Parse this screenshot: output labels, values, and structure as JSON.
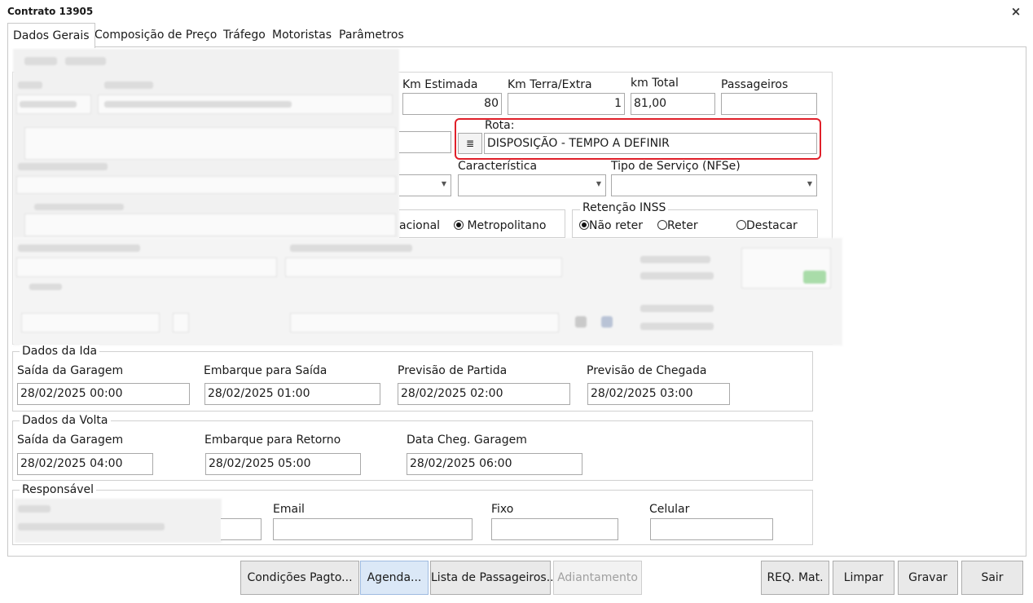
{
  "window": {
    "title": "Contrato 13905",
    "close_glyph": "×"
  },
  "tabs": [
    {
      "label": "Dados Gerais"
    },
    {
      "label": "Composição de Preço"
    },
    {
      "label": "Tráfego"
    },
    {
      "label": "Motoristas"
    },
    {
      "label": "Parâmetros"
    }
  ],
  "metrics": {
    "km_estimada": {
      "label": "Km Estimada",
      "value": "80"
    },
    "km_terra": {
      "label": "Km Terra/Extra",
      "value": "1"
    },
    "km_total": {
      "label": "km Total",
      "value": "81,00"
    },
    "passageiros": {
      "label": "Passageiros",
      "value": ""
    }
  },
  "rota": {
    "label": "Rota:",
    "value": "DISPOSIÇÃO - TEMPO A DEFINIR",
    "button_glyph": "≣"
  },
  "caracteristica": {
    "label": "Característica",
    "value": ""
  },
  "tipo_servico": {
    "label": "Tipo de Serviço (NFSe)",
    "value": ""
  },
  "abrangencia": {
    "option_partial": "acional",
    "option_metropolitano": "Metropolitano"
  },
  "retencao": {
    "title": "Retenção INSS",
    "options": [
      "Não reter",
      "Reter",
      "Destacar"
    ],
    "selected": "Não reter"
  },
  "ida": {
    "title": "Dados da Ida",
    "fields": [
      {
        "label": "Saída da Garagem",
        "value": "28/02/2025 00:00"
      },
      {
        "label": "Embarque para Saída",
        "value": "28/02/2025 01:00"
      },
      {
        "label": "Previsão de Partida",
        "value": "28/02/2025 02:00"
      },
      {
        "label": "Previsão de Chegada",
        "value": "28/02/2025 03:00"
      }
    ]
  },
  "volta": {
    "title": "Dados da Volta",
    "fields": [
      {
        "label": "Saída da Garagem",
        "value": "28/02/2025 04:00"
      },
      {
        "label": "Embarque para Retorno",
        "value": "28/02/2025 05:00"
      },
      {
        "label": "Data Cheg. Garagem",
        "value": "28/02/2025 06:00"
      }
    ]
  },
  "responsavel": {
    "title": "Responsável",
    "email": {
      "label": "Email",
      "value": ""
    },
    "fixo": {
      "label": "Fixo",
      "value": ""
    },
    "celular": {
      "label": "Celular",
      "value": ""
    }
  },
  "buttons": {
    "condicoes": "Condições Pagto...",
    "agenda": "Agenda...",
    "lista": "Lista de Passageiros...",
    "adiantamento": "Adiantamento",
    "req": "REQ. Mat.",
    "limpar": "Limpar",
    "gravar": "Gravar",
    "sair": "Sair"
  }
}
